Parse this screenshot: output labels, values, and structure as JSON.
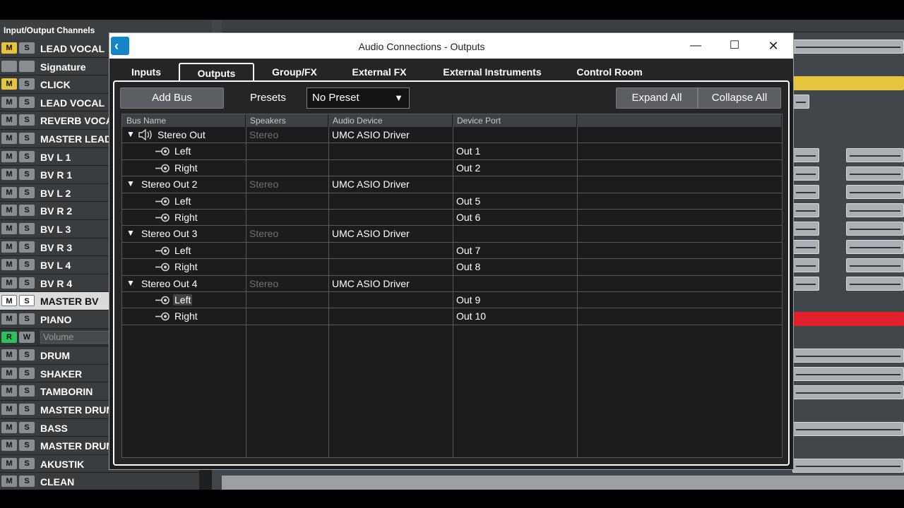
{
  "background": {
    "panel_title": "Input/Output Channels",
    "tracks": [
      {
        "name": "LEAD VOCAL",
        "m": "M",
        "s": "S",
        "m_color": "yellow"
      },
      {
        "name": "Signature",
        "m": "",
        "s": "",
        "m_color": "grey"
      },
      {
        "name": "CLICK",
        "m": "M",
        "s": "S",
        "m_color": "yellow"
      },
      {
        "name": "LEAD VOCAL",
        "m": "M",
        "s": "S",
        "m_color": "grey"
      },
      {
        "name": "REVERB VOCAL",
        "m": "M",
        "s": "S",
        "m_color": "grey"
      },
      {
        "name": "MASTER LEAD",
        "m": "M",
        "s": "S",
        "m_color": "grey"
      },
      {
        "name": "BV L 1",
        "m": "M",
        "s": "S",
        "m_color": "grey"
      },
      {
        "name": "BV R 1",
        "m": "M",
        "s": "S",
        "m_color": "grey"
      },
      {
        "name": "BV L 2",
        "m": "M",
        "s": "S",
        "m_color": "grey"
      },
      {
        "name": "BV R 2",
        "m": "M",
        "s": "S",
        "m_color": "grey"
      },
      {
        "name": "BV L 3",
        "m": "M",
        "s": "S",
        "m_color": "grey"
      },
      {
        "name": "BV R 3",
        "m": "M",
        "s": "S",
        "m_color": "grey"
      },
      {
        "name": "BV L 4",
        "m": "M",
        "s": "S",
        "m_color": "grey"
      },
      {
        "name": "BV R 4",
        "m": "M",
        "s": "S",
        "m_color": "grey"
      },
      {
        "name": "MASTER BV",
        "m": "M",
        "s": "S",
        "m_color": "grey",
        "selected": true
      },
      {
        "name": "PIANO",
        "m": "M",
        "s": "S",
        "m_color": "grey"
      },
      {
        "name": "Volume",
        "m": "R",
        "s": "W",
        "m_color": "green",
        "automation": true
      },
      {
        "name": "DRUM",
        "m": "M",
        "s": "S",
        "m_color": "grey"
      },
      {
        "name": "SHAKER",
        "m": "M",
        "s": "S",
        "m_color": "grey"
      },
      {
        "name": "TAMBORIN",
        "m": "M",
        "s": "S",
        "m_color": "grey"
      },
      {
        "name": "MASTER DRUM",
        "m": "M",
        "s": "S",
        "m_color": "grey"
      },
      {
        "name": "BASS",
        "m": "M",
        "s": "S",
        "m_color": "grey"
      },
      {
        "name": "MASTER DRUM",
        "m": "M",
        "s": "S",
        "m_color": "grey"
      },
      {
        "name": "AKUSTIK",
        "m": "M",
        "s": "S",
        "m_color": "grey"
      },
      {
        "name": "CLEAN",
        "m": "M",
        "s": "S",
        "m_color": "grey"
      }
    ]
  },
  "dialog": {
    "title": "Audio Connections - Outputs",
    "window_controls": {
      "minimize": "—",
      "maximize": "☐",
      "close": "✕"
    },
    "tabs": [
      {
        "label": "Inputs",
        "active": false
      },
      {
        "label": "Outputs",
        "active": true
      },
      {
        "label": "Group/FX",
        "active": false
      },
      {
        "label": "External FX",
        "active": false
      },
      {
        "label": "External Instruments",
        "active": false
      },
      {
        "label": "Control Room",
        "active": false
      }
    ],
    "toolbar": {
      "add_bus": "Add Bus",
      "presets_label": "Presets",
      "preset_value": "No Preset",
      "expand_all": "Expand All",
      "collapse_all": "Collapse All"
    },
    "columns": [
      "Bus Name",
      "Speakers",
      "Audio Device",
      "Device Port"
    ],
    "rows": [
      {
        "type": "bus",
        "name": "Stereo Out",
        "speakers": "Stereo",
        "device": "UMC ASIO Driver",
        "port": "",
        "icon": "speaker-icon"
      },
      {
        "type": "channel",
        "name": "Left",
        "speakers": "",
        "device": "",
        "port": "Out 1"
      },
      {
        "type": "channel",
        "name": "Right",
        "speakers": "",
        "device": "",
        "port": "Out 2"
      },
      {
        "type": "bus",
        "name": "Stereo Out 2",
        "speakers": "Stereo",
        "device": "UMC ASIO Driver",
        "port": ""
      },
      {
        "type": "channel",
        "name": "Left",
        "speakers": "",
        "device": "",
        "port": "Out 5"
      },
      {
        "type": "channel",
        "name": "Right",
        "speakers": "",
        "device": "",
        "port": "Out 6"
      },
      {
        "type": "bus",
        "name": "Stereo Out 3",
        "speakers": "Stereo",
        "device": "UMC ASIO Driver",
        "port": ""
      },
      {
        "type": "channel",
        "name": "Left",
        "speakers": "",
        "device": "",
        "port": "Out 7"
      },
      {
        "type": "channel",
        "name": "Right",
        "speakers": "",
        "device": "",
        "port": "Out 8"
      },
      {
        "type": "bus",
        "name": "Stereo Out 4",
        "speakers": "Stereo",
        "device": "UMC ASIO Driver",
        "port": ""
      },
      {
        "type": "channel",
        "name": "Left",
        "speakers": "",
        "device": "",
        "port": "Out 9",
        "highlighted": true
      },
      {
        "type": "channel",
        "name": "Right",
        "speakers": "",
        "device": "",
        "port": "Out 10"
      }
    ]
  },
  "colors": {
    "accent": "#1584c9",
    "mute_yellow": "#e6c53c",
    "read_green": "#2ec05c",
    "clip_red": "#e2202a"
  }
}
